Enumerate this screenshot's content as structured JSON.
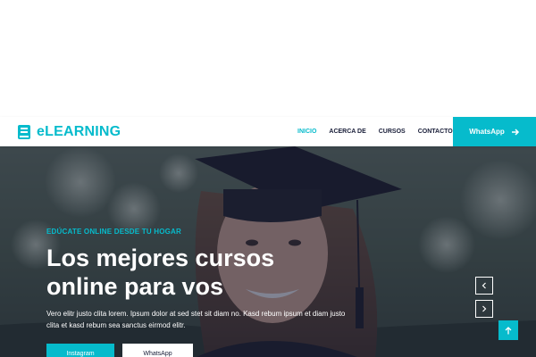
{
  "brand": {
    "name": "eLEARNING",
    "icon": "book-icon"
  },
  "nav": {
    "items": [
      {
        "label": "INICIO",
        "active": true
      },
      {
        "label": "ACERCA DE",
        "active": false
      },
      {
        "label": "CURSOS",
        "active": false
      },
      {
        "label": "CONTACTO",
        "active": false
      }
    ],
    "cta_label": "WhatsApp",
    "cta_icon": "arrow-right-icon"
  },
  "hero": {
    "eyebrow": "EDÚCATE ONLINE DESDE TU HOGAR",
    "title": "Los mejores cursos online para vos",
    "description": "Vero elitr justo clita lorem. Ipsum dolor at sed stet sit diam no. Kasd rebum ipsum et diam justo clita et kasd rebum sea sanctus eirmod elitr.",
    "buttons": [
      {
        "label": "Instagram"
      },
      {
        "label": "WhatsApp"
      }
    ],
    "prev_icon": "chevron-left-icon",
    "next_icon": "chevron-right-icon"
  },
  "back_to_top_icon": "arrow-up-icon",
  "colors": {
    "accent": "#06BBCC",
    "dark": "#181d38",
    "white": "#ffffff"
  }
}
